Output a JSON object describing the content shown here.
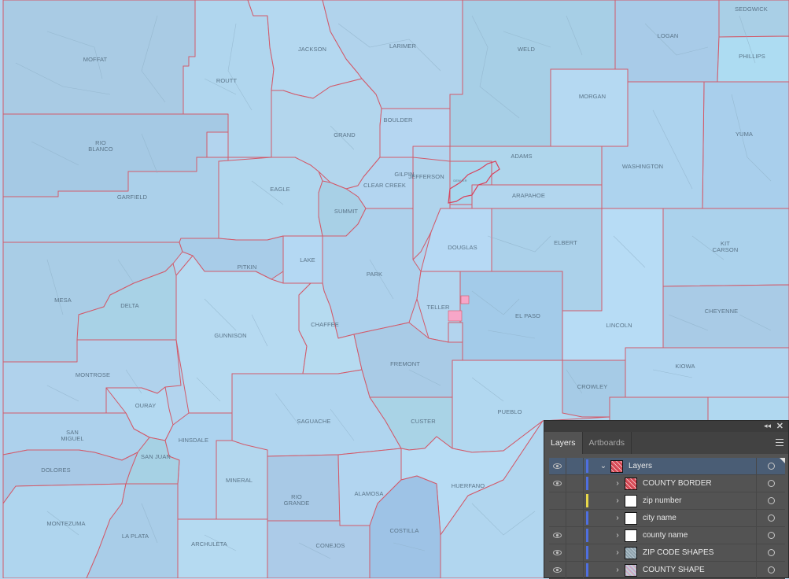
{
  "map": {
    "state": "Colorado",
    "highlight_color": "#f7a6c8",
    "county_border_color": "#d25a6a",
    "counties": [
      {
        "name": "MOFFAT"
      },
      {
        "name": "JACKSON"
      },
      {
        "name": "LARIMER"
      },
      {
        "name": "WELD"
      },
      {
        "name": "LOGAN"
      },
      {
        "name": "SEDGWICK"
      },
      {
        "name": "PHILLIPS"
      },
      {
        "name": "ROUTT"
      },
      {
        "name": "MORGAN"
      },
      {
        "name": "BOULDER"
      },
      {
        "name": "GRAND"
      },
      {
        "name": "YUMA"
      },
      {
        "name": "RIO BLANCO",
        "lines": [
          "RIO",
          "BLANCO"
        ]
      },
      {
        "name": "ADAMS"
      },
      {
        "name": "GILPIN"
      },
      {
        "name": "JEFFERSON"
      },
      {
        "name": "WASHINGTON"
      },
      {
        "name": "EAGLE"
      },
      {
        "name": "CLEAR CREEK"
      },
      {
        "name": "GARFIELD"
      },
      {
        "name": "ARAPAHOE"
      },
      {
        "name": "SUMMIT"
      },
      {
        "name": "DOUGLAS"
      },
      {
        "name": "ELBERT"
      },
      {
        "name": "KIT CARSON",
        "lines": [
          "KIT",
          "CARSON"
        ]
      },
      {
        "name": "PITKIN"
      },
      {
        "name": "LAKE"
      },
      {
        "name": "PARK"
      },
      {
        "name": "MESA"
      },
      {
        "name": "DELTA"
      },
      {
        "name": "TELLER"
      },
      {
        "name": "EL PASO"
      },
      {
        "name": "CHEYENNE"
      },
      {
        "name": "CHAFFEE"
      },
      {
        "name": "LINCOLN"
      },
      {
        "name": "GUNNISON"
      },
      {
        "name": "FREMONT"
      },
      {
        "name": "KIOWA"
      },
      {
        "name": "MONTROSE"
      },
      {
        "name": "CROWLEY"
      },
      {
        "name": "OURAY"
      },
      {
        "name": "PUEBLO"
      },
      {
        "name": "SAGUACHE"
      },
      {
        "name": "CUSTER"
      },
      {
        "name": "SAN MIGUEL",
        "lines": [
          "SAN",
          "MIGUEL"
        ]
      },
      {
        "name": "HINSDALE"
      },
      {
        "name": "SAN JUAN"
      },
      {
        "name": "DOLORES"
      },
      {
        "name": "HUERFANO"
      },
      {
        "name": "MINERAL"
      },
      {
        "name": "ALAMOSA"
      },
      {
        "name": "RIO GRANDE",
        "lines": [
          "RIO",
          "GRANDE"
        ]
      },
      {
        "name": "MONTEZUMA"
      },
      {
        "name": "COSTILLA"
      },
      {
        "name": "LA PLATA"
      },
      {
        "name": "ARCHULETA"
      },
      {
        "name": "CONEJOS"
      },
      {
        "name": "DENVER"
      }
    ]
  },
  "panel": {
    "collapse_icon": "double-chevron-left",
    "close_icon": "close-x",
    "tabs": [
      {
        "label": "Layers",
        "active": true
      },
      {
        "label": "Artboards",
        "active": false
      }
    ],
    "menu_icon": "hamburger-menu",
    "layers": [
      {
        "label": "Layers",
        "visible": true,
        "expanded": true,
        "color": "#4f6fe0",
        "thumb": "red",
        "selected": true
      },
      {
        "label": "COUNTY BORDER",
        "visible": true,
        "expanded": false,
        "color": "#4f6fe0",
        "thumb": "red"
      },
      {
        "label": "zip number",
        "visible": false,
        "expanded": false,
        "color": "#e8d84a",
        "thumb": "white"
      },
      {
        "label": "city name",
        "visible": false,
        "expanded": false,
        "color": "#4f6fe0",
        "thumb": "white"
      },
      {
        "label": "county name",
        "visible": true,
        "expanded": false,
        "color": "#4f6fe0",
        "thumb": "white"
      },
      {
        "label": "ZIP CODE SHAPES",
        "visible": true,
        "expanded": false,
        "color": "#4f6fe0",
        "thumb": "gray"
      },
      {
        "label": "COUNTY SHAPE",
        "visible": true,
        "expanded": false,
        "color": "#4f6fe0",
        "thumb": "multi"
      }
    ]
  }
}
